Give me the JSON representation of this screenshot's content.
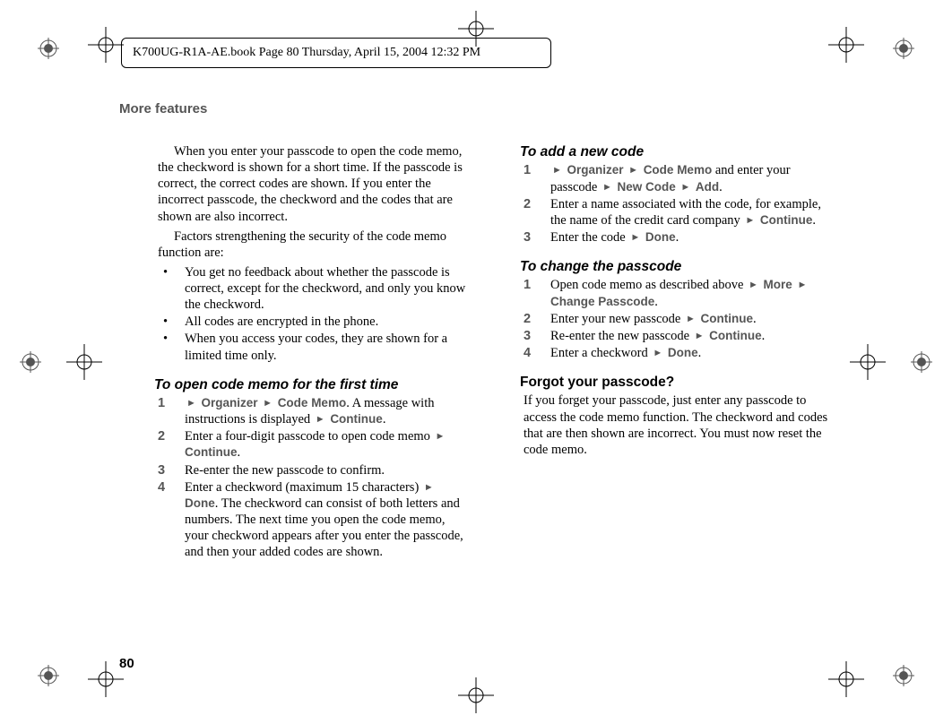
{
  "header": {
    "text": "K700UG-R1A-AE.book  Page 80  Thursday, April 15, 2004  12:32 PM"
  },
  "section_title": "More features",
  "page_number": "80",
  "left": {
    "para1": "When you enter your passcode to open the code memo, the checkword is shown for a short time. If the passcode is correct, the correct codes are shown. If you enter the incorrect passcode, the checkword and the codes that are shown are also incorrect.",
    "para2": "Factors strengthening the security of the code memo function are:",
    "bullets": [
      "You get no feedback about whether the passcode is correct, except for the checkword, and only you know the checkword.",
      "All codes are encrypted in the phone.",
      "When you access your codes, they are shown for a limited time only."
    ],
    "open_heading": "To open code memo for the first time",
    "open_steps": {
      "s1_before": "",
      "s1_menu1": "Organizer",
      "s1_menu2": "Code Memo",
      "s1_mid": ". A message with instructions is displayed ",
      "s1_menu3": "Continue",
      "s1_after": ".",
      "s2_before": "Enter a four-digit passcode to open code memo ",
      "s2_menu1": "Continue",
      "s2_after": ".",
      "s3": "Re-enter the new passcode to confirm.",
      "s4_before": "Enter a checkword (maximum 15 characters) ",
      "s4_menu1": "Done",
      "s4_after": ". The checkword can consist of both letters and numbers. The next time you open the code memo, your checkword appears after you enter the passcode, and then your added codes are shown."
    }
  },
  "right": {
    "add_heading": "To add a new code",
    "add_steps": {
      "s1_before": "",
      "s1_menu1": "Organizer",
      "s1_menu2": "Code Memo",
      "s1_mid": " and enter your passcode ",
      "s1_menu3": "New Code",
      "s1_menu4": "Add",
      "s1_after": ".",
      "s2_before": "Enter a name associated with the code, for example, the name of the credit card company ",
      "s2_menu1": "Continue",
      "s2_after": ".",
      "s3_before": "Enter the code ",
      "s3_menu1": "Done",
      "s3_after": "."
    },
    "change_heading": "To change the passcode",
    "change_steps": {
      "s1_before": "Open code memo as described above ",
      "s1_menu1": "More",
      "s1_menu2": "Change Passcode",
      "s1_after": ".",
      "s2_before": "Enter your new passcode ",
      "s2_menu1": "Continue",
      "s2_after": ".",
      "s3_before": "Re-enter the new passcode ",
      "s3_menu1": "Continue",
      "s3_after": ".",
      "s4_before": "Enter a checkword ",
      "s4_menu1": "Done",
      "s4_after": "."
    },
    "forgot_heading": "Forgot your passcode?",
    "forgot_para": "If you forget your passcode, just enter any passcode to access the code memo function. The checkword and codes that are then shown are incorrect. You must now reset the code memo."
  },
  "nums": {
    "n1": "1",
    "n2": "2",
    "n3": "3",
    "n4": "4"
  }
}
